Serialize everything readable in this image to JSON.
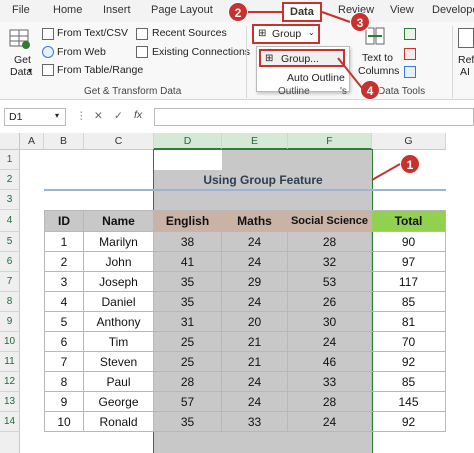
{
  "tabs": [
    "File",
    "Home",
    "Insert",
    "Page Layout",
    "Data",
    "Review",
    "View",
    "Develope"
  ],
  "ribbon": {
    "get_data": "Get",
    "get_data2": "Data",
    "from_text_csv": "From Text/CSV",
    "from_web": "From Web",
    "from_table_range": "From Table/Range",
    "recent_sources": "Recent Sources",
    "existing_connections": "Existing Connections",
    "group_label": "Get & Transform Data",
    "group_button": "Group",
    "group_menu_item": "Group...",
    "auto_outline": "Auto Outline",
    "outline_label": "Outline",
    "text_to": "Text to",
    "columns": "Columns",
    "data_tools_label": "Data Tools",
    "refi": "Refi",
    "ai": "AI"
  },
  "formula_bar": {
    "name_box": "D1",
    "fx": "fx"
  },
  "columns": [
    "A",
    "B",
    "C",
    "D",
    "E",
    "F",
    "G"
  ],
  "rows": [
    "1",
    "2",
    "3",
    "4",
    "5",
    "6",
    "7",
    "8",
    "9",
    "10",
    "11",
    "12",
    "13",
    "14"
  ],
  "title": "Using Group Feature",
  "table": {
    "headers": [
      "ID",
      "Name",
      "English",
      "Maths",
      "Social Science",
      "Total"
    ],
    "rows": [
      [
        "1",
        "Marilyn",
        "38",
        "24",
        "28",
        "90"
      ],
      [
        "2",
        "John",
        "41",
        "24",
        "32",
        "97"
      ],
      [
        "3",
        "Joseph",
        "35",
        "29",
        "53",
        "117"
      ],
      [
        "4",
        "Daniel",
        "35",
        "24",
        "26",
        "85"
      ],
      [
        "5",
        "Anthony",
        "31",
        "20",
        "30",
        "81"
      ],
      [
        "6",
        "Tim",
        "25",
        "21",
        "24",
        "70"
      ],
      [
        "7",
        "Steven",
        "25",
        "21",
        "46",
        "92"
      ],
      [
        "8",
        "Paul",
        "28",
        "24",
        "33",
        "85"
      ],
      [
        "9",
        "George",
        "57",
        "24",
        "28",
        "145"
      ],
      [
        "10",
        "Ronald",
        "35",
        "33",
        "24",
        "92"
      ]
    ]
  },
  "badges": [
    "1",
    "2",
    "3",
    "4"
  ],
  "colors": {
    "accent_red": "#c8322e",
    "header_gray": "#c8c8c8",
    "subject_header": "#c9b2a6",
    "total_green": "#92d050",
    "selection": "#c8c8c8"
  }
}
